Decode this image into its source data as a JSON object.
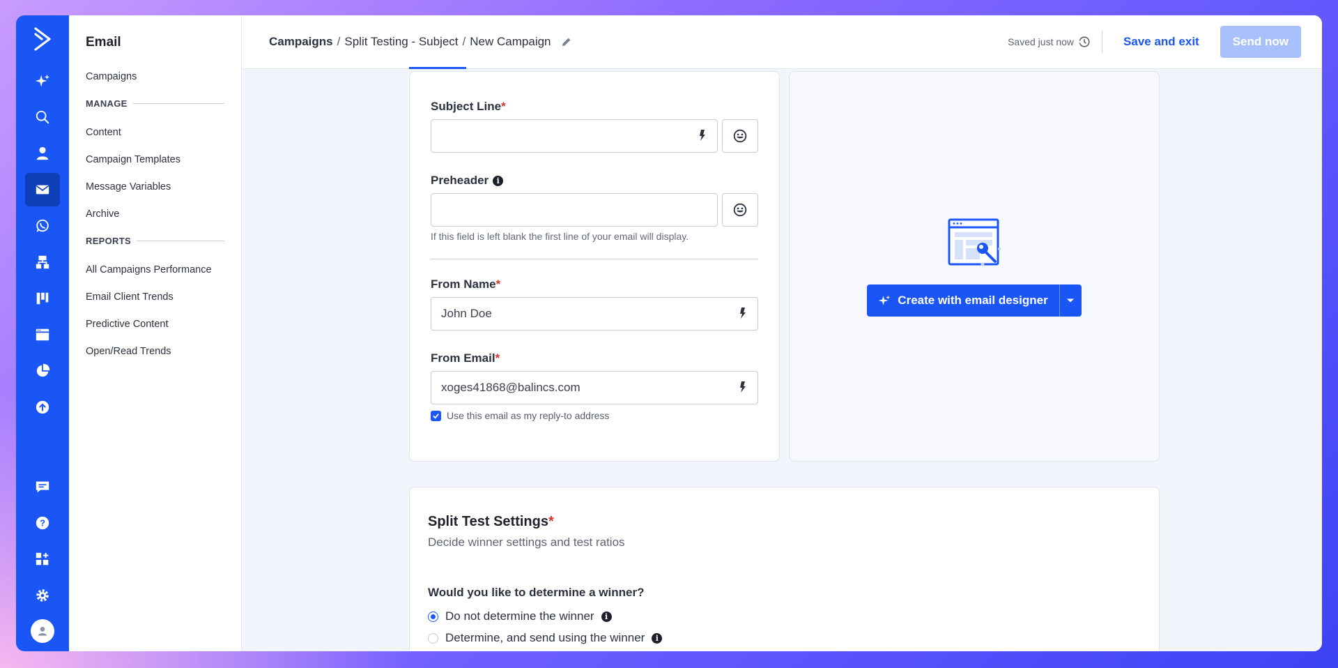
{
  "colors": {
    "brand": "#1a56f5",
    "required": "#d6312c"
  },
  "rail": {
    "items": [
      "logo-icon",
      "sparkle-icon",
      "search-icon",
      "contacts-icon",
      "email-icon",
      "whatsapp-icon",
      "automations-icon",
      "deals-icon",
      "website-icon",
      "reports-icon",
      "upload-icon"
    ],
    "bottom": [
      "conversations-icon",
      "help-icon",
      "apps-icon",
      "settings-icon",
      "avatar-icon"
    ],
    "active": "email-icon"
  },
  "sidebar": {
    "title": "Email",
    "top_link": "Campaigns",
    "manage_label": "MANAGE",
    "manage_items": [
      "Content",
      "Campaign Templates",
      "Message Variables",
      "Archive"
    ],
    "reports_label": "REPORTS",
    "reports_items": [
      "All Campaigns Performance",
      "Email Client Trends",
      "Predictive Content",
      "Open/Read Trends"
    ]
  },
  "header": {
    "crumb_1": "Campaigns",
    "crumb_2": "Split Testing - Subject",
    "crumb_3": "New Campaign",
    "saved": "Saved just now",
    "save_exit": "Save and exit",
    "send_now": "Send now"
  },
  "form": {
    "subject_label": "Subject Line",
    "subject_value": "",
    "preheader_label": "Preheader",
    "preheader_value": "",
    "preheader_hint": "If this field is left blank the first line of your email will display.",
    "from_name_label": "From Name",
    "from_name_value": "John Doe",
    "from_email_label": "From Email",
    "from_email_value": "xoges41868@balincs.com",
    "reply_to_label": "Use this email as my reply-to address",
    "reply_to_checked": true,
    "required_mark": "*"
  },
  "designer": {
    "button_label": "Create with email designer"
  },
  "split": {
    "title": "Split Test Settings",
    "subtitle": "Decide winner settings and test ratios",
    "question": "Would you like to determine a winner?",
    "options": [
      "Do not determine the winner",
      "Determine, and send using the winner"
    ],
    "selected": 0
  }
}
